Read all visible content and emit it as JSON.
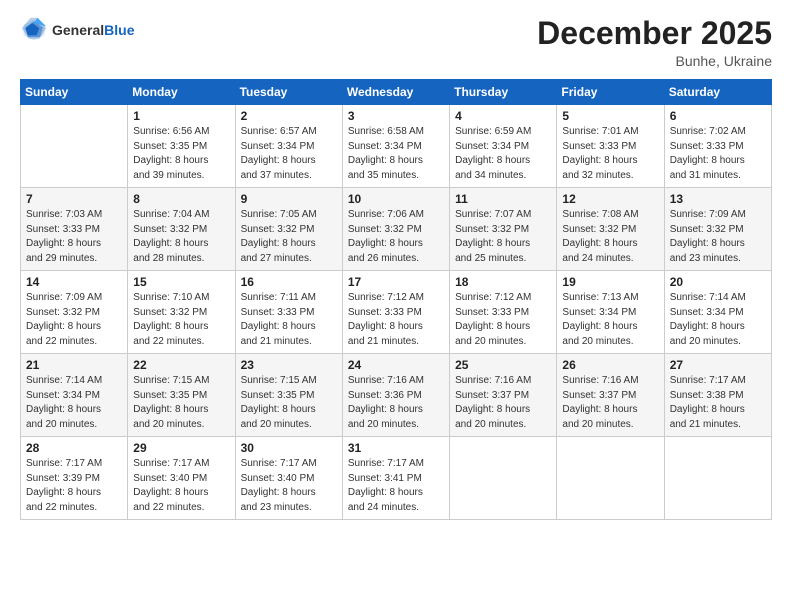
{
  "header": {
    "logo": {
      "general": "General",
      "blue": "Blue"
    },
    "title": "December 2025",
    "location": "Bunhe, Ukraine"
  },
  "weekdays": [
    "Sunday",
    "Monday",
    "Tuesday",
    "Wednesday",
    "Thursday",
    "Friday",
    "Saturday"
  ],
  "weeks": [
    [
      {
        "day": "",
        "info": ""
      },
      {
        "day": "1",
        "info": "Sunrise: 6:56 AM\nSunset: 3:35 PM\nDaylight: 8 hours\nand 39 minutes."
      },
      {
        "day": "2",
        "info": "Sunrise: 6:57 AM\nSunset: 3:34 PM\nDaylight: 8 hours\nand 37 minutes."
      },
      {
        "day": "3",
        "info": "Sunrise: 6:58 AM\nSunset: 3:34 PM\nDaylight: 8 hours\nand 35 minutes."
      },
      {
        "day": "4",
        "info": "Sunrise: 6:59 AM\nSunset: 3:34 PM\nDaylight: 8 hours\nand 34 minutes."
      },
      {
        "day": "5",
        "info": "Sunrise: 7:01 AM\nSunset: 3:33 PM\nDaylight: 8 hours\nand 32 minutes."
      },
      {
        "day": "6",
        "info": "Sunrise: 7:02 AM\nSunset: 3:33 PM\nDaylight: 8 hours\nand 31 minutes."
      }
    ],
    [
      {
        "day": "7",
        "info": "Sunrise: 7:03 AM\nSunset: 3:33 PM\nDaylight: 8 hours\nand 29 minutes."
      },
      {
        "day": "8",
        "info": "Sunrise: 7:04 AM\nSunset: 3:32 PM\nDaylight: 8 hours\nand 28 minutes."
      },
      {
        "day": "9",
        "info": "Sunrise: 7:05 AM\nSunset: 3:32 PM\nDaylight: 8 hours\nand 27 minutes."
      },
      {
        "day": "10",
        "info": "Sunrise: 7:06 AM\nSunset: 3:32 PM\nDaylight: 8 hours\nand 26 minutes."
      },
      {
        "day": "11",
        "info": "Sunrise: 7:07 AM\nSunset: 3:32 PM\nDaylight: 8 hours\nand 25 minutes."
      },
      {
        "day": "12",
        "info": "Sunrise: 7:08 AM\nSunset: 3:32 PM\nDaylight: 8 hours\nand 24 minutes."
      },
      {
        "day": "13",
        "info": "Sunrise: 7:09 AM\nSunset: 3:32 PM\nDaylight: 8 hours\nand 23 minutes."
      }
    ],
    [
      {
        "day": "14",
        "info": "Sunrise: 7:09 AM\nSunset: 3:32 PM\nDaylight: 8 hours\nand 22 minutes."
      },
      {
        "day": "15",
        "info": "Sunrise: 7:10 AM\nSunset: 3:32 PM\nDaylight: 8 hours\nand 22 minutes."
      },
      {
        "day": "16",
        "info": "Sunrise: 7:11 AM\nSunset: 3:33 PM\nDaylight: 8 hours\nand 21 minutes."
      },
      {
        "day": "17",
        "info": "Sunrise: 7:12 AM\nSunset: 3:33 PM\nDaylight: 8 hours\nand 21 minutes."
      },
      {
        "day": "18",
        "info": "Sunrise: 7:12 AM\nSunset: 3:33 PM\nDaylight: 8 hours\nand 20 minutes."
      },
      {
        "day": "19",
        "info": "Sunrise: 7:13 AM\nSunset: 3:34 PM\nDaylight: 8 hours\nand 20 minutes."
      },
      {
        "day": "20",
        "info": "Sunrise: 7:14 AM\nSunset: 3:34 PM\nDaylight: 8 hours\nand 20 minutes."
      }
    ],
    [
      {
        "day": "21",
        "info": "Sunrise: 7:14 AM\nSunset: 3:34 PM\nDaylight: 8 hours\nand 20 minutes."
      },
      {
        "day": "22",
        "info": "Sunrise: 7:15 AM\nSunset: 3:35 PM\nDaylight: 8 hours\nand 20 minutes."
      },
      {
        "day": "23",
        "info": "Sunrise: 7:15 AM\nSunset: 3:35 PM\nDaylight: 8 hours\nand 20 minutes."
      },
      {
        "day": "24",
        "info": "Sunrise: 7:16 AM\nSunset: 3:36 PM\nDaylight: 8 hours\nand 20 minutes."
      },
      {
        "day": "25",
        "info": "Sunrise: 7:16 AM\nSunset: 3:37 PM\nDaylight: 8 hours\nand 20 minutes."
      },
      {
        "day": "26",
        "info": "Sunrise: 7:16 AM\nSunset: 3:37 PM\nDaylight: 8 hours\nand 20 minutes."
      },
      {
        "day": "27",
        "info": "Sunrise: 7:17 AM\nSunset: 3:38 PM\nDaylight: 8 hours\nand 21 minutes."
      }
    ],
    [
      {
        "day": "28",
        "info": "Sunrise: 7:17 AM\nSunset: 3:39 PM\nDaylight: 8 hours\nand 22 minutes."
      },
      {
        "day": "29",
        "info": "Sunrise: 7:17 AM\nSunset: 3:40 PM\nDaylight: 8 hours\nand 22 minutes."
      },
      {
        "day": "30",
        "info": "Sunrise: 7:17 AM\nSunset: 3:40 PM\nDaylight: 8 hours\nand 23 minutes."
      },
      {
        "day": "31",
        "info": "Sunrise: 7:17 AM\nSunset: 3:41 PM\nDaylight: 8 hours\nand 24 minutes."
      },
      {
        "day": "",
        "info": ""
      },
      {
        "day": "",
        "info": ""
      },
      {
        "day": "",
        "info": ""
      }
    ]
  ]
}
